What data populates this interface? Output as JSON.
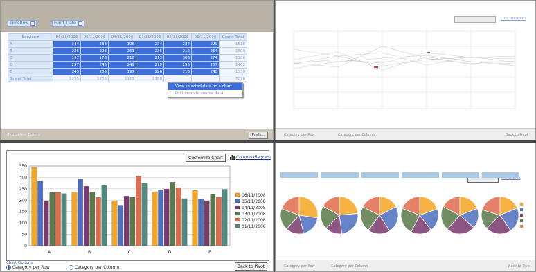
{
  "pivot": {
    "filter_fields": [
      "TimeRow",
      "Fund_Date"
    ],
    "row_field": "Service",
    "column_headers": [
      "06/11/2008",
      "05/11/2008",
      "04/11/2008",
      "03/11/2008",
      "02/11/2008",
      "01/11/2008",
      "Grand Total"
    ],
    "rows": [
      {
        "label": "A",
        "values": [
          "344",
          "283",
          "196",
          "234",
          "234",
          "229",
          "1518"
        ]
      },
      {
        "label": "B",
        "values": [
          "236",
          "293",
          "261",
          "236",
          "212",
          "264",
          "1500"
        ]
      },
      {
        "label": "C",
        "values": [
          "197",
          "178",
          "218",
          "213",
          "306",
          "274",
          "1386"
        ]
      },
      {
        "label": "D",
        "values": [
          "237",
          "245",
          "249",
          "279",
          "255",
          "207",
          "1462"
        ]
      },
      {
        "label": "E",
        "values": [
          "243",
          "205",
          "197",
          "226",
          "213",
          "248",
          "1330"
        ]
      }
    ],
    "grand_total": {
      "label": "Grand Total",
      "values": [
        "1255",
        "1206",
        "1112",
        "1188",
        "",
        "",
        "7870"
      ]
    },
    "context_menu": [
      "View selected data on a chart",
      "Drill-down to source data"
    ],
    "status_text": "<Problem> Empty",
    "prefs_button": "Prefs..."
  },
  "p2": {
    "toolbar_left": "Category per Row",
    "toolbar_right": "Category per Column",
    "back_button": "Back to Pivot",
    "link": "Line diagram"
  },
  "chart": {
    "customize_button": "Customize Chart",
    "diagram_link": "Column diagram",
    "options_label": "Chart Options",
    "radio_row": "Category per Row",
    "radio_column": "Category per Column",
    "back_button": "Back to Pivot",
    "y_ticks": [
      "350",
      "300",
      "250",
      "200",
      "150",
      "100",
      "50",
      "0"
    ]
  },
  "chart_data": {
    "type": "bar",
    "categories": [
      "A",
      "B",
      "C",
      "D",
      "E"
    ],
    "ylim": [
      0,
      350
    ],
    "series": [
      {
        "name": "06/11/2008",
        "color": "#f5a623",
        "values": [
          344,
          236,
          197,
          237,
          243
        ]
      },
      {
        "name": "05/11/2008",
        "color": "#4d6fbf",
        "values": [
          283,
          293,
          178,
          245,
          205
        ]
      },
      {
        "name": "04/11/2008",
        "color": "#7b3a6e",
        "values": [
          196,
          261,
          218,
          249,
          197
        ]
      },
      {
        "name": "03/11/2008",
        "color": "#5a7a4a",
        "values": [
          234,
          236,
          213,
          279,
          226
        ]
      },
      {
        "name": "02/11/2008",
        "color": "#e06c4c",
        "values": [
          234,
          212,
          306,
          255,
          213
        ]
      },
      {
        "name": "01/11/2008",
        "color": "#4f8a80",
        "values": [
          229,
          264,
          274,
          207,
          248
        ]
      }
    ]
  },
  "p4": {
    "link": "Pie charts",
    "back_button": "Back to Pivot"
  }
}
